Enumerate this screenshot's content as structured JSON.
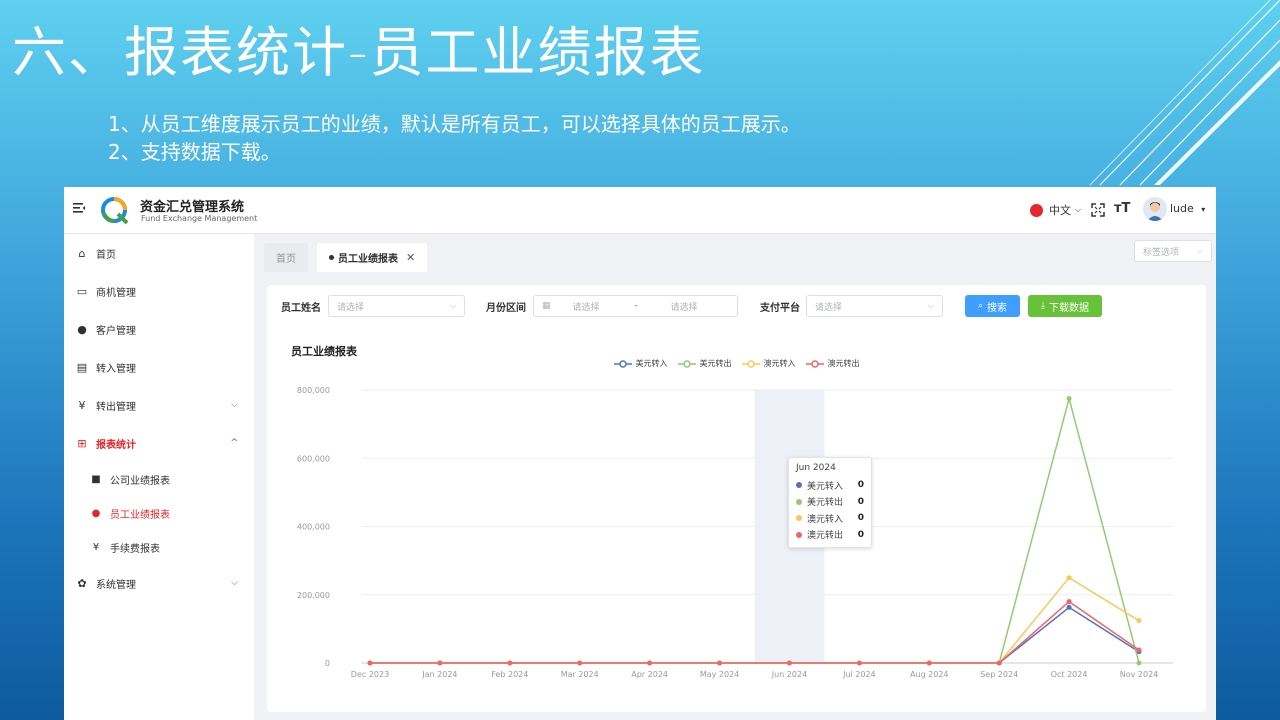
{
  "slide": {
    "title": "六、报表统计-员工业绩报表",
    "point1": "1、从员工维度展示员工的业绩，默认是所有员工，可以选择具体的员工展示。",
    "point2": "2、支持数据下载。"
  },
  "header": {
    "app_title": "资金汇兑管理系统",
    "app_subtitle": "Fund Exchange Management",
    "language": "中文",
    "username": "lude"
  },
  "sidebar": {
    "items": [
      {
        "label": "首页",
        "icon": "dashboard-icon"
      },
      {
        "label": "商机管理",
        "icon": "book-icon"
      },
      {
        "label": "客户管理",
        "icon": "users-icon"
      },
      {
        "label": "转入管理",
        "icon": "documents-icon"
      },
      {
        "label": "转出管理",
        "icon": "yen-icon"
      },
      {
        "label": "报表统计",
        "icon": "report-icon"
      },
      {
        "label": "系统管理",
        "icon": "gear-icon"
      }
    ],
    "sub_items": [
      {
        "label": "公司业绩报表"
      },
      {
        "label": "员工业绩报表"
      },
      {
        "label": "手续费报表"
      }
    ]
  },
  "tabs": {
    "home": "首页",
    "current": "员工业绩报表",
    "tag_select_placeholder": "标签选项"
  },
  "filters": {
    "employee_label": "员工姓名",
    "employee_placeholder": "请选择",
    "month_label": "月份区间",
    "month_start_placeholder": "请选择",
    "month_sep": "-",
    "month_end_placeholder": "请选择",
    "platform_label": "支付平台",
    "platform_placeholder": "请选择",
    "search_button": "搜索",
    "download_button": "下载数据"
  },
  "chart_data": {
    "type": "line",
    "title": "员工业绩报表",
    "x": [
      "Dec 2023",
      "Jan 2024",
      "Feb 2024",
      "Mar 2024",
      "Apr 2024",
      "May 2024",
      "Jun 2024",
      "Jul 2024",
      "Aug 2024",
      "Sep 2024",
      "Oct 2024",
      "Nov 2024"
    ],
    "y_ticks": [
      "800,000",
      "600,000",
      "400,000",
      "200,000",
      "0"
    ],
    "ylim": [
      0,
      800000
    ],
    "series": [
      {
        "name": "美元转入",
        "color": "#5470c6",
        "values": [
          0,
          0,
          0,
          0,
          0,
          0,
          0,
          0,
          0,
          0,
          163000,
          33000
        ]
      },
      {
        "name": "美元转出",
        "color": "#91cc75",
        "values": [
          0,
          0,
          0,
          0,
          0,
          0,
          0,
          0,
          0,
          0,
          775000,
          0
        ]
      },
      {
        "name": "澳元转入",
        "color": "#fac858",
        "values": [
          0,
          0,
          0,
          0,
          0,
          0,
          0,
          0,
          0,
          0,
          250000,
          124000
        ]
      },
      {
        "name": "澳元转出",
        "color": "#ee6666",
        "values": [
          0,
          0,
          0,
          0,
          0,
          0,
          0,
          0,
          0,
          0,
          180000,
          38000
        ]
      }
    ],
    "grid": true,
    "legend_position": "top-center",
    "highlighted_category": "Jun 2024"
  },
  "tooltip": {
    "title": "Jun 2024",
    "rows": [
      {
        "label": "美元转入",
        "value": "0",
        "color": "#5470c6"
      },
      {
        "label": "美元转出",
        "value": "0",
        "color": "#91cc75"
      },
      {
        "label": "澳元转入",
        "value": "0",
        "color": "#fac858"
      },
      {
        "label": "澳元转出",
        "value": "0",
        "color": "#ee6666"
      }
    ]
  }
}
